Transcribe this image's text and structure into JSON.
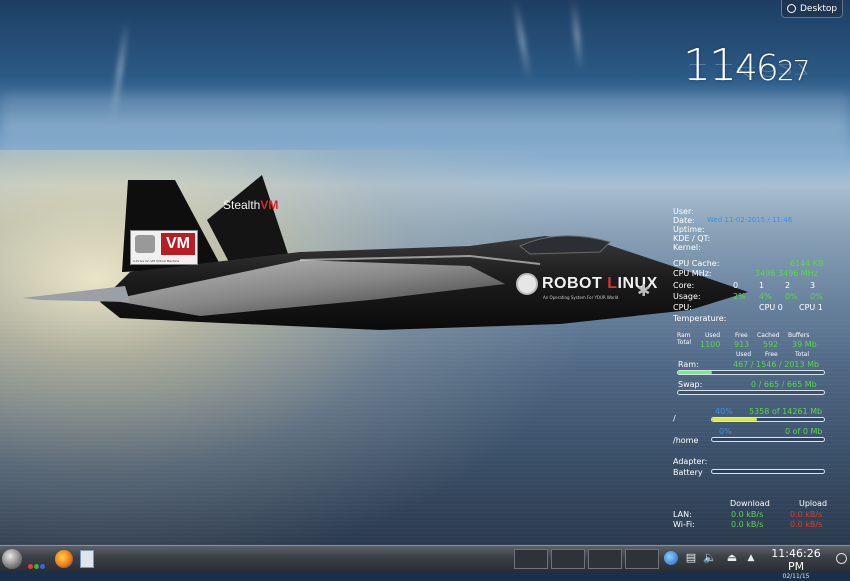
{
  "desktop_button": {
    "label": "Desktop"
  },
  "clock_widget": {
    "hours": "11",
    "minutes": "46",
    "seconds": "27"
  },
  "jet": {
    "tail_brand": "Stealth",
    "tail_brand_mark": "VM",
    "badge_label": "VM",
    "badge_sub": "C-Drive On VM Virtual Machine",
    "fuselage_brand_prefix": "ROBOT",
    "fuselage_brand_l": "L",
    "fuselage_brand_suffix": "INUX",
    "fuselage_tagline": "An Operating System For YOUR World"
  },
  "sysmon": {
    "user_label": "User:",
    "date_label": "Date:",
    "date_value": "Wed 11-02-2015 / 11:46",
    "uptime_label": "Uptime:",
    "kde_qt_label": "KDE / QT:",
    "kernel_label": "Kernel:",
    "cpu_cache_label": "CPU Cache:",
    "cpu_cache_value": "6144 KB",
    "cpu_mhz_label": "CPU MHz:",
    "cpu_mhz_value": "3496 3496  MHz",
    "core_label": "Core:",
    "cores": [
      "0",
      "1",
      "2",
      "3"
    ],
    "usage_label": "Usage:",
    "usage": [
      "2%",
      "4%",
      "0%",
      "0%"
    ],
    "cpu_label": "CPU:",
    "cpu_names": [
      "CPU 0",
      "CPU 1"
    ],
    "temperature_label": "Temperature:",
    "ram_table": {
      "ram_header": "Ram",
      "total_header": "Total",
      "used_header": "Used",
      "free_header": "Free",
      "cached_header": "Cached",
      "buffers_header": "Buffers",
      "used": "1100",
      "free": "913",
      "cached": "592",
      "buffers": "39 Mb"
    },
    "ram_sub_headers": {
      "used": "Used",
      "free": "Free",
      "total": "Total"
    },
    "ram_label": "Ram:",
    "ram_value": "467 / 1546 / 2013 Mb",
    "ram_fraction": 0.23,
    "swap_label": "Swap:",
    "swap_value": "0 / 665 / 665 Mb",
    "swap_fraction": 0.0,
    "root_label": "/",
    "root_percent": "40%",
    "root_value": "5358  of 14261 Mb",
    "root_fraction": 0.4,
    "home_label": "/home",
    "home_percent": "0%",
    "home_value": "0  of 0 Mb",
    "home_fraction": 0.0,
    "adapter_label": "Adapter:",
    "battery_label": "Battery",
    "battery_fraction": 0.0,
    "download_header": "Download",
    "upload_header": "Upload",
    "lan_label": "LAN:",
    "lan_down": "0.0  kB/s",
    "lan_up": "0.0  kB/s",
    "wifi_label": "Wi-Fi:",
    "wifi_down": "0.0  kB/s",
    "wifi_up": "0.0  kB/s"
  },
  "taskbar": {
    "time": "11:46:26 PM",
    "date": "02/11/15",
    "colors": {
      "accent_green": "#59d74c",
      "accent_blue": "#3f8fe0",
      "accent_red": "#e03a2a"
    },
    "launchers": [
      "kmenu-icon",
      "activities-icon",
      "firefox-icon",
      "notes-icon"
    ],
    "tray_icons": [
      "network-icon",
      "clipboard-icon",
      "volume-icon",
      "device-notifier-icon",
      "expand-tray-icon"
    ]
  }
}
